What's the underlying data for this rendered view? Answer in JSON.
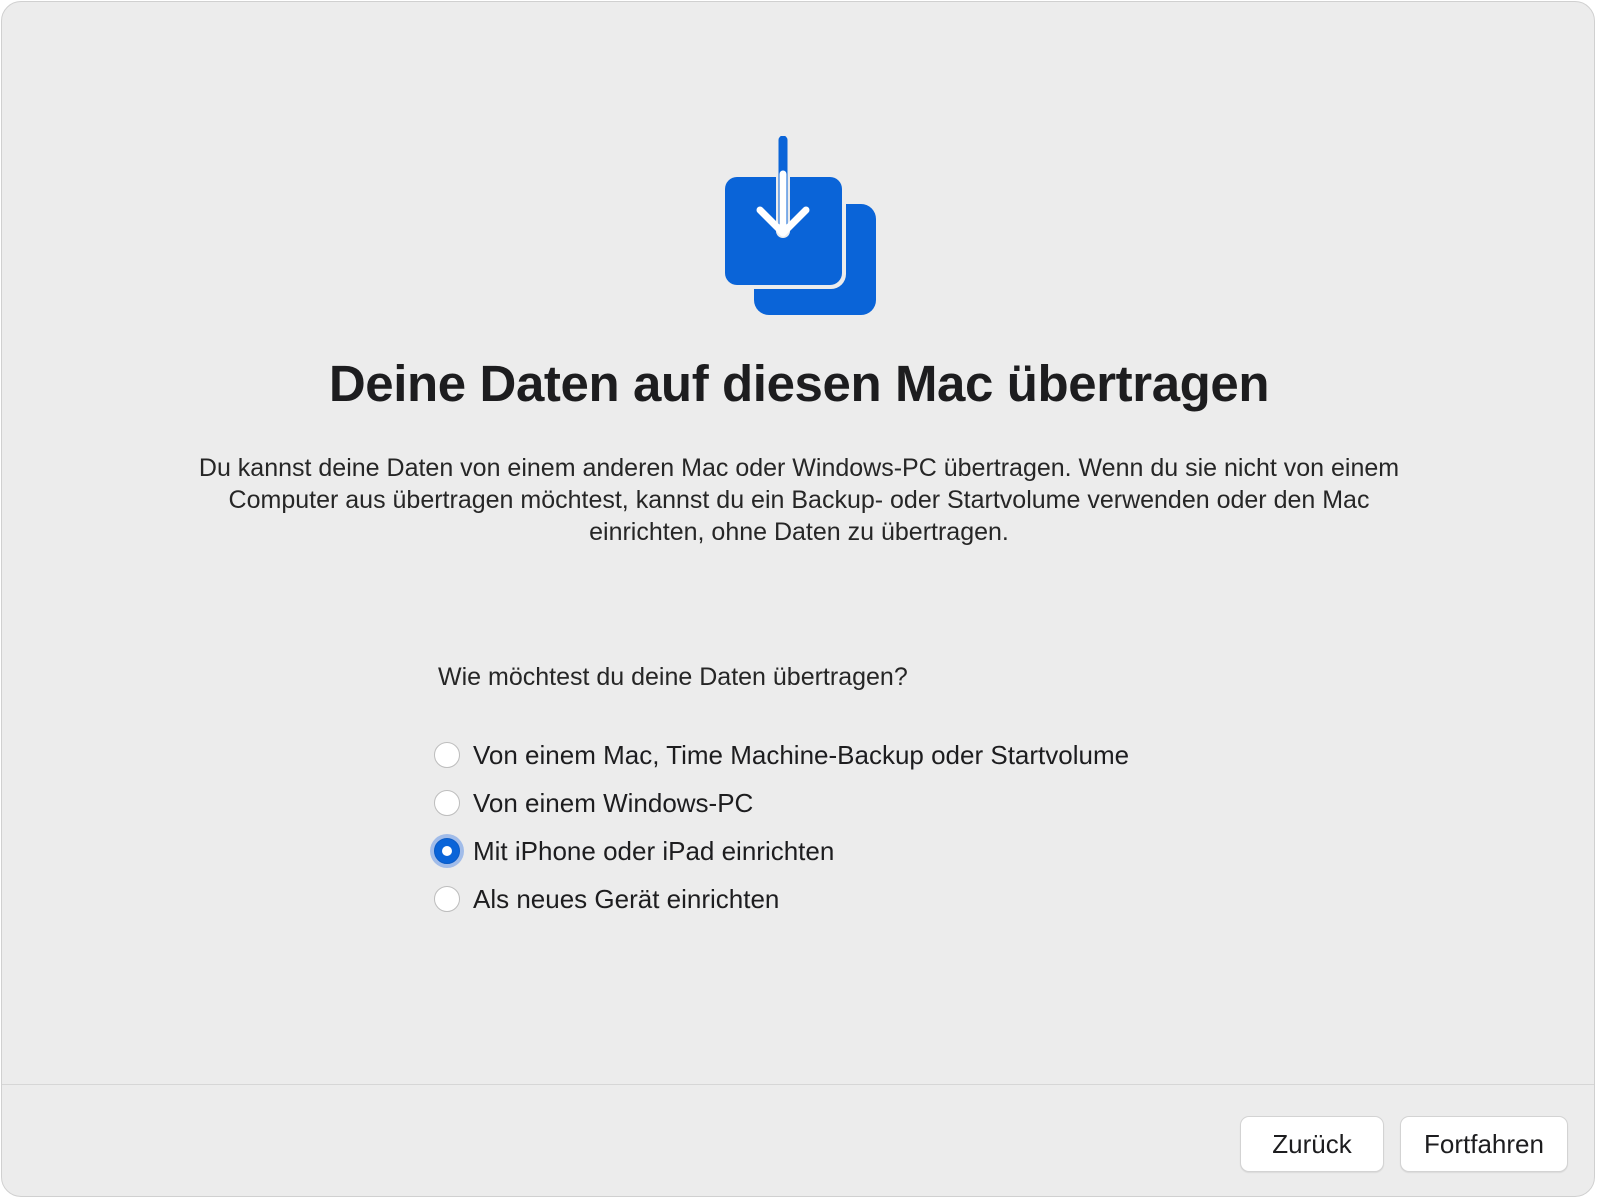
{
  "colors": {
    "accent": "#0a64d8",
    "window_background": "#ececec"
  },
  "hero": {
    "icon": "migration-download-icon"
  },
  "title": "Deine Daten auf diesen Mac übertragen",
  "description": "Du kannst deine Daten von einem anderen Mac oder Windows-PC übertragen. Wenn du sie nicht von einem Computer aus übertragen möchtest, kannst du ein Backup- oder Startvolume verwenden oder den Mac einrichten, ohne Daten zu übertragen.",
  "question": "Wie möchtest du deine Daten übertragen?",
  "options": [
    {
      "label": "Von einem Mac, Time Machine-Backup oder Startvolume",
      "selected": false
    },
    {
      "label": "Von einem Windows-PC",
      "selected": false
    },
    {
      "label": "Mit iPhone oder iPad einrichten",
      "selected": true
    },
    {
      "label": "Als neues Gerät einrichten",
      "selected": false
    }
  ],
  "footer": {
    "back_label": "Zurück",
    "continue_label": "Fortfahren"
  }
}
